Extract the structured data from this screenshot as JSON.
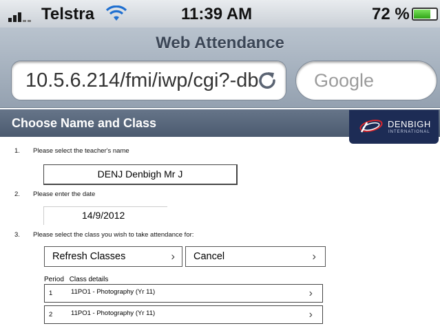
{
  "status_bar": {
    "carrier": "Telstra",
    "time": "11:39 AM",
    "battery_percent": "72 %",
    "battery_level": 0.72,
    "signal_icon": "signal-bars-icon",
    "wifi_icon": "wifi-icon"
  },
  "browser": {
    "title": "Web Attendance",
    "url": "10.5.6.214/fmi/iwp/cgi?-db=",
    "search_placeholder": "Google",
    "refresh_icon": "refresh-icon"
  },
  "header": {
    "title": "Choose Name and Class",
    "logo_text": "DENBIGH",
    "logo_subtext": "INTERNATIONAL"
  },
  "form": {
    "steps": [
      {
        "number": "1.",
        "label": "Please select the teacher's name"
      },
      {
        "number": "2.",
        "label": "Please enter the date"
      },
      {
        "number": "3.",
        "label": "Please select the class you wish to take attendance for:"
      }
    ],
    "teacher_value": "DENJ Denbigh Mr J",
    "date_value": "14/9/2012",
    "refresh_classes_label": "Refresh Classes",
    "cancel_label": "Cancel",
    "chevron": "›",
    "period_header": "Period",
    "class_details_header": "Class details",
    "classes": [
      {
        "period": "1",
        "details": "11PO1 - Photography (Yr 11)"
      },
      {
        "period": "2",
        "details": "11PO1 - Photography (Yr 11)"
      }
    ]
  },
  "colors": {
    "nav_bar": "#a6b1be",
    "section_header": "#566579",
    "logo_bg": "#1d2c55",
    "battery_green": "#4cc22d"
  }
}
